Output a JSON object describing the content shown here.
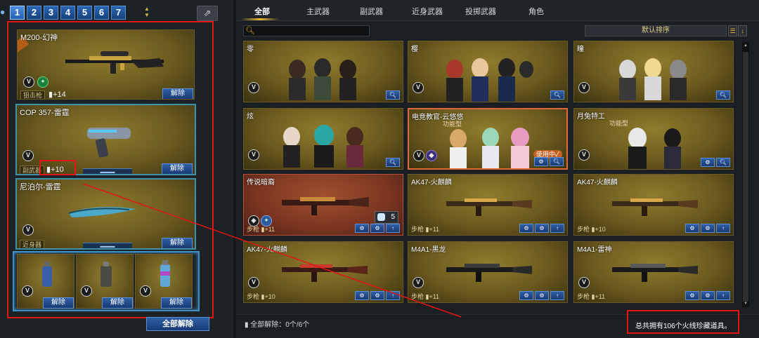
{
  "loadout": {
    "tabs": [
      "1",
      "2",
      "3",
      "4",
      "5",
      "6",
      "7"
    ],
    "active_tab": 0
  },
  "equipped": {
    "primary": {
      "title": "M200-幻神",
      "category": "狙击枪",
      "level": "+14",
      "unequip": "解除"
    },
    "secondary": {
      "title": "COP 357-雷霆",
      "category": "副武器",
      "level": "+10",
      "unequip": "解除"
    },
    "melee": {
      "title": "尼泊尔-雷霆",
      "category": "近身器",
      "unequip": "解除"
    },
    "grenades": [
      {
        "unequip": "解除"
      },
      {
        "unequip": "解除"
      },
      {
        "unequip": "解除"
      }
    ],
    "unequip_all": "全部解除"
  },
  "category_tabs": [
    "全部",
    "主武器",
    "副武器",
    "近身武器",
    "投掷武器",
    "角色"
  ],
  "sort": {
    "label": "默认排序"
  },
  "items": [
    {
      "title": "零"
    },
    {
      "title": "樱"
    },
    {
      "title": "瞳"
    },
    {
      "title": "炫"
    },
    {
      "title": "电竞教官-云悠悠",
      "subtitle": "功能型",
      "status": "使用中✓"
    },
    {
      "title": "月兔特工",
      "subtitle": "功能型"
    },
    {
      "title": "传说暗裔",
      "tag": "步枪",
      "level": "+11",
      "count": "5"
    },
    {
      "title": "AK47-火麒麟",
      "tag": "步枪",
      "level": "+11"
    },
    {
      "title": "AK47-火麒麟",
      "tag": "步枪",
      "level": "+10"
    },
    {
      "title": "AK47-火麒麟",
      "tag": "步枪",
      "level": "+10"
    },
    {
      "title": "M4A1-黑龙",
      "tag": "步枪",
      "level": "+11"
    },
    {
      "title": "M4A1-雷神",
      "tag": "步枪",
      "level": "+11"
    }
  ],
  "footer": {
    "unequip_all_status": "全部解除：0个/6个",
    "total_collection": "总共拥有106个火线珍藏道具。"
  }
}
